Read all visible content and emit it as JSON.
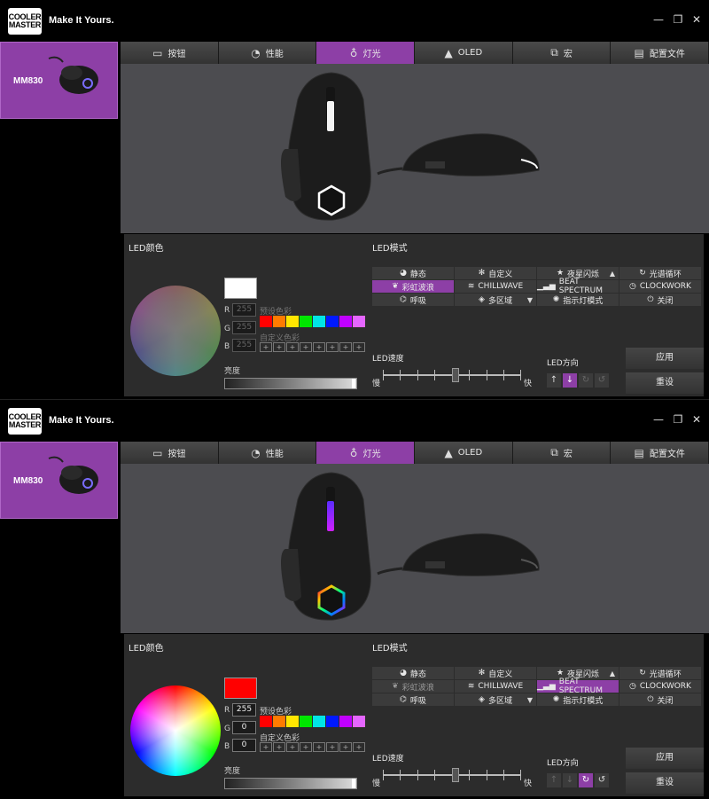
{
  "brand": {
    "logo_line1": "COOLER",
    "logo_line2": "MASTER",
    "tagline": "Make It Yours."
  },
  "window_controls": [
    "minimize-icon",
    "maximize-icon",
    "close-icon"
  ],
  "device": {
    "name": "MM830"
  },
  "tabs": [
    {
      "label": "按钮",
      "icon": "mouse-icon"
    },
    {
      "label": "性能",
      "icon": "gauge-icon"
    },
    {
      "label": "灯光",
      "icon": "bulb-icon"
    },
    {
      "label": "OLED",
      "icon": "oled-icon"
    },
    {
      "label": "宏",
      "icon": "macro-icon"
    },
    {
      "label": "配置文件",
      "icon": "profile-icon"
    }
  ],
  "active_tab": "灯光",
  "accent_color": "#8d3fa6",
  "led_color": {
    "title": "LED颜色",
    "preset_label": "预设色彩",
    "custom_label": "自定义色彩",
    "brightness_label": "亮度",
    "preset_colors": [
      "#ff0000",
      "#ff7b00",
      "#ffe600",
      "#00e600",
      "#00e5e5",
      "#0019ff",
      "#c000ff",
      "#e566ff"
    ],
    "custom_slot_symbol": "+",
    "rgb_labels": {
      "r": "R",
      "g": "G",
      "b": "B"
    }
  },
  "led_mode": {
    "title": "LED模式",
    "modes": [
      {
        "label": "静态",
        "icon": "palette-icon"
      },
      {
        "label": "自定义",
        "icon": "gear-icon"
      },
      {
        "label": "夜星闪烁",
        "icon": "star-icon"
      },
      {
        "label": "光谱循环",
        "icon": "cycle-icon"
      },
      {
        "label": "彩虹波浪",
        "icon": "leaf-icon"
      },
      {
        "label": "CHILLWAVE",
        "icon": "wave-icon"
      },
      {
        "label": "BEAT SPECTRUM",
        "icon": "equalizer-icon"
      },
      {
        "label": "CLOCKWORK",
        "icon": "clock-icon"
      },
      {
        "label": "呼吸",
        "icon": "gamepad-icon"
      },
      {
        "label": "多区域",
        "icon": "layers-icon"
      },
      {
        "label": "指示灯模式",
        "icon": "bulb-icon"
      },
      {
        "label": "关闭",
        "icon": "power-icon"
      }
    ]
  },
  "speed": {
    "title": "LED速度",
    "slow": "慢",
    "fast": "快",
    "level": 0.5
  },
  "direction": {
    "title": "LED方向"
  },
  "buttons": {
    "apply": "应用",
    "reset": "重设"
  },
  "state_1": {
    "swatch": "#ffffff",
    "r": "255",
    "g": "255",
    "b": "255",
    "active_mode": "彩虹波浪",
    "active_direction": "down",
    "mouse_glow": "white"
  },
  "state_2": {
    "swatch": "#ff0000",
    "r": "255",
    "g": "0",
    "b": "0",
    "active_mode": "BEAT SPECTRUM",
    "active_direction": "rotate-cw",
    "mouse_glow": "rainbow"
  }
}
